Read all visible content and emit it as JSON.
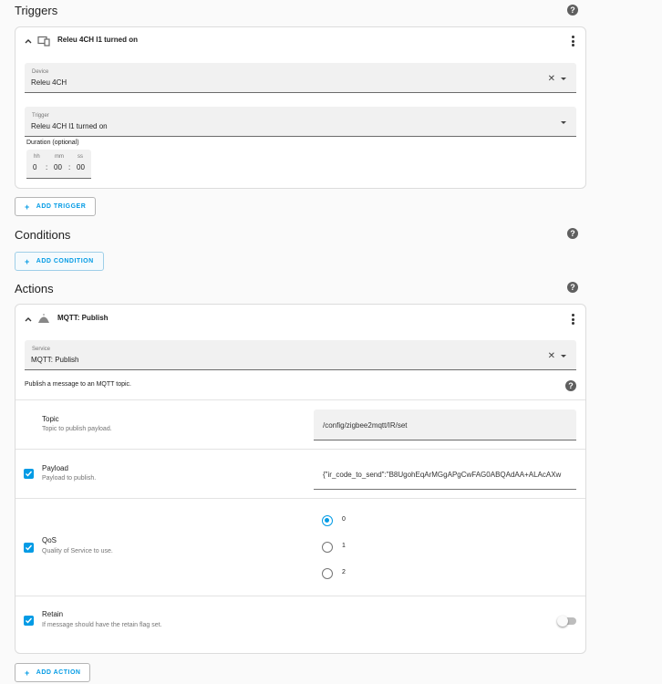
{
  "triggers": {
    "title": "Triggers",
    "card_title": "Releu 4CH l1 turned on",
    "device": {
      "label": "Device",
      "value": "Releu 4CH"
    },
    "trigger": {
      "label": "Trigger",
      "value": "Releu 4CH l1 turned on"
    },
    "duration": {
      "label": "Duration (optional)",
      "hh_label": "hh",
      "mm_label": "mm",
      "ss_label": "ss",
      "hh": "0",
      "mm": "00",
      "ss": "00",
      "sep": ":"
    },
    "add_button": "ADD TRIGGER"
  },
  "conditions": {
    "title": "Conditions",
    "add_button": "ADD CONDITION"
  },
  "actions": {
    "title": "Actions",
    "card_title": "MQTT: Publish",
    "service": {
      "label": "Service",
      "value": "MQTT: Publish"
    },
    "service_description": "Publish a message to an MQTT topic.",
    "topic": {
      "title": "Topic",
      "desc": "Topic to publish payload.",
      "value": "/config/zigbee2mqtt/IR/set"
    },
    "payload": {
      "title": "Payload",
      "desc": "Payload to publish.",
      "value": "{\"ir_code_to_send\":\"B8UgohEqArMGgAPgCwFAG0ABQAdAA+ALAcAXw"
    },
    "qos": {
      "title": "QoS",
      "desc": "Quality of Service to use.",
      "options": [
        "0",
        "1",
        "2"
      ],
      "selected": "0"
    },
    "retain": {
      "title": "Retain",
      "desc": "If message should have the retain flag set.",
      "enabled": false
    },
    "add_button": "ADD ACTION"
  },
  "colors": {
    "accent": "#039be5",
    "background": "#fafafa"
  },
  "icons": {
    "help": "question-mark-circle-icon",
    "chevron": "chevron-up-icon",
    "device": "remote-device-icon",
    "mqtt": "cloud-broadcast-icon",
    "menu": "kebab-menu-icon",
    "clear": "close-icon",
    "dropdown": "caret-down-icon",
    "check": "checkmark-icon"
  }
}
